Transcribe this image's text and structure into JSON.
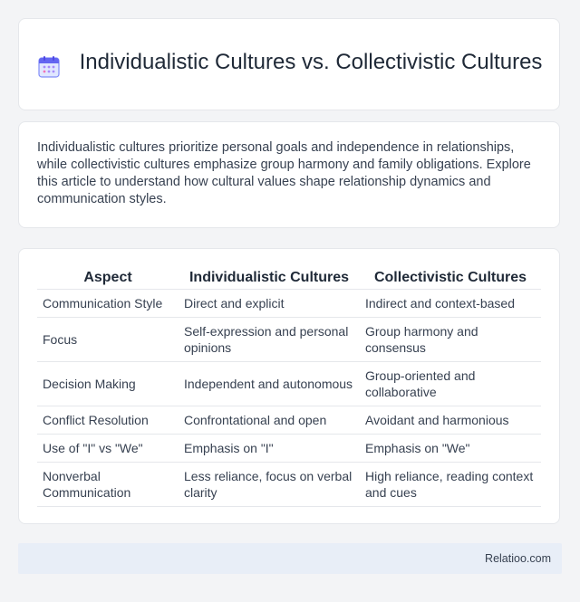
{
  "header": {
    "title": "Individualistic Cultures vs. Collectivistic Cultures",
    "icon": "calendar-icon"
  },
  "intro": {
    "text": "Individualistic cultures prioritize personal goals and independence in relationships, while collectivistic cultures emphasize group harmony and family obligations. Explore this article to understand how cultural values shape relationship dynamics and communication styles."
  },
  "table": {
    "headers": [
      "Aspect",
      "Individualistic Cultures",
      "Collectivistic Cultures"
    ],
    "rows": [
      [
        "Communication Style",
        "Direct and explicit",
        "Indirect and context-based"
      ],
      [
        "Focus",
        "Self-expression and personal opinions",
        "Group harmony and consensus"
      ],
      [
        "Decision Making",
        "Independent and autonomous",
        "Group-oriented and collaborative"
      ],
      [
        "Conflict Resolution",
        "Confrontational and open",
        "Avoidant and harmonious"
      ],
      [
        "Use of \"I\" vs \"We\"",
        "Emphasis on \"I\"",
        "Emphasis on \"We\""
      ],
      [
        "Nonverbal Communication",
        "Less reliance, focus on verbal clarity",
        "High reliance, reading context and cues"
      ]
    ]
  },
  "footer": {
    "text": "Relatioo.com"
  },
  "colors": {
    "background": "#f3f4f6",
    "card": "#ffffff",
    "footer": "#e8eef7",
    "icon_accent": "#6366f1"
  }
}
